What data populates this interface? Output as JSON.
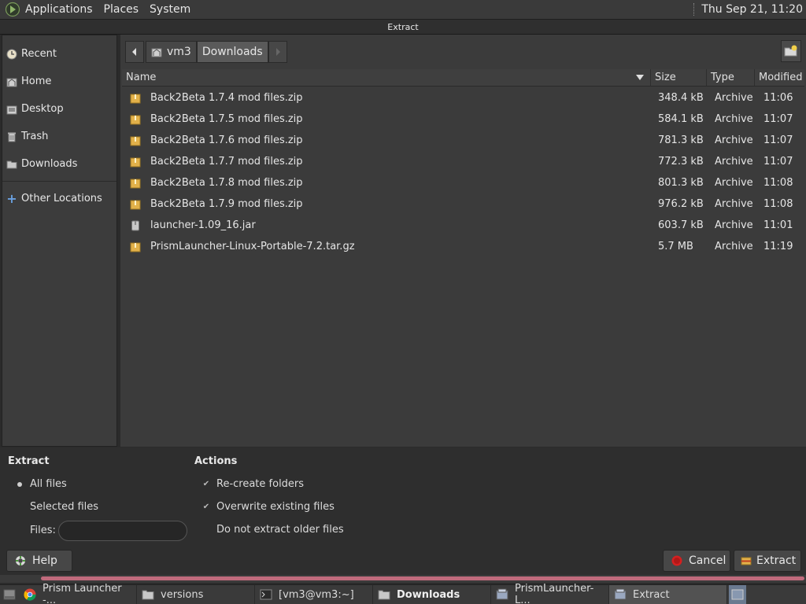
{
  "top_panel": {
    "menus": [
      "Applications",
      "Places",
      "System"
    ],
    "clock": "Thu Sep 21, 11:20"
  },
  "dialog": {
    "title": "Extract"
  },
  "sidebar": {
    "items": [
      {
        "label": "Recent",
        "icon": "recent-icon"
      },
      {
        "label": "Home",
        "icon": "home-icon"
      },
      {
        "label": "Desktop",
        "icon": "desktop-icon"
      },
      {
        "label": "Trash",
        "icon": "trash-icon"
      },
      {
        "label": "Downloads",
        "icon": "folder-icon"
      }
    ],
    "other_locations": "Other Locations"
  },
  "path_bar": {
    "segments": [
      "vm3",
      "Downloads"
    ]
  },
  "columns": {
    "name": "Name",
    "size": "Size",
    "type": "Type",
    "modified": "Modified"
  },
  "files": [
    {
      "name": "Back2Beta 1.7.4 mod files.zip",
      "size": "348.4 kB",
      "type": "Archive",
      "modified": "11:06",
      "icon": "archive-icon"
    },
    {
      "name": "Back2Beta 1.7.5 mod files.zip",
      "size": "584.1 kB",
      "type": "Archive",
      "modified": "11:07",
      "icon": "archive-icon"
    },
    {
      "name": "Back2Beta 1.7.6 mod files.zip",
      "size": "781.3 kB",
      "type": "Archive",
      "modified": "11:07",
      "icon": "archive-icon"
    },
    {
      "name": "Back2Beta 1.7.7 mod files.zip",
      "size": "772.3 kB",
      "type": "Archive",
      "modified": "11:07",
      "icon": "archive-icon"
    },
    {
      "name": "Back2Beta 1.7.8 mod files.zip",
      "size": "801.3 kB",
      "type": "Archive",
      "modified": "11:08",
      "icon": "archive-icon"
    },
    {
      "name": "Back2Beta 1.7.9 mod files.zip",
      "size": "976.2 kB",
      "type": "Archive",
      "modified": "11:08",
      "icon": "archive-icon"
    },
    {
      "name": "launcher-1.09_16.jar",
      "size": "603.7 kB",
      "type": "Archive",
      "modified": "11:01",
      "icon": "jar-icon"
    },
    {
      "name": "PrismLauncher-Linux-Portable-7.2.tar.gz",
      "size": "5.7 MB",
      "type": "Archive",
      "modified": "11:19",
      "icon": "archive-icon"
    }
  ],
  "extract_options": {
    "title": "Extract",
    "all_files": "All files",
    "selected_files": "Selected files",
    "files_label": "Files:",
    "files_value": "",
    "selected": "all_files"
  },
  "actions": {
    "title": "Actions",
    "recreate_folders": "Re-create folders",
    "recreate_checked": true,
    "overwrite": "Overwrite existing files",
    "overwrite_checked": true,
    "no_older": "Do not extract older files",
    "no_older_checked": false
  },
  "buttons": {
    "help": "Help",
    "cancel": "Cancel",
    "extract": "Extract"
  },
  "taskbar": {
    "tasks": [
      {
        "label": "Prism Launcher -...",
        "icon": "chrome-icon"
      },
      {
        "label": "versions",
        "icon": "folder-icon"
      },
      {
        "label": "[vm3@vm3:~]",
        "icon": "terminal-icon"
      },
      {
        "label": "Downloads",
        "icon": "folder-icon"
      },
      {
        "label": "PrismLauncher-L...",
        "icon": "archive-manager-icon"
      },
      {
        "label": "Extract",
        "icon": "archive-manager-icon"
      }
    ]
  },
  "colors": {
    "accent_pink": "#c06a7c",
    "archive_yellow": "#e2b14a",
    "cancel_red": "#d42020"
  }
}
